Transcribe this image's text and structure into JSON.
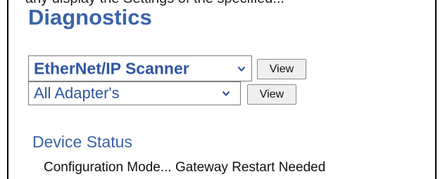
{
  "top_clipped_text": "any display the Settings of the specified...",
  "page_title": "Diagnostics",
  "scanner_select": {
    "selected": "EtherNet/IP Scanner"
  },
  "adapter_select": {
    "selected": "All Adapter's"
  },
  "view_button_label": "View",
  "device_status": {
    "heading": "Device Status",
    "message": "Configuration Mode... Gateway Restart Needed"
  },
  "icons": {
    "dropdown": "chevron-down-icon"
  },
  "colors": {
    "accent": "#3a63a8",
    "select_text": "#2f56a0",
    "button_bg": "#efefef",
    "border": "#000000"
  }
}
